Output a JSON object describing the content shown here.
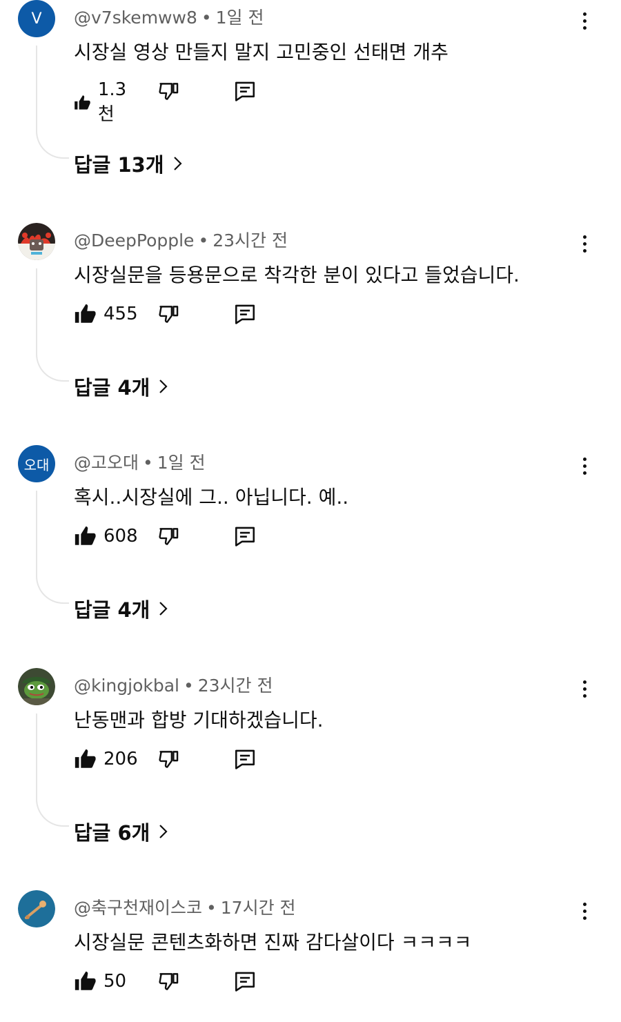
{
  "comments": [
    {
      "avatar_letter": "V",
      "author": "@v7skemww8",
      "time": "1일 전",
      "text": "시장실 영상 만들지 말지 고민중인 선태면 개추",
      "likes": "1.3천",
      "replies_label": "답글 13개"
    },
    {
      "author": "@DeepPopple",
      "time": "23시간 전",
      "text": "시장실문을 등용문으로 착각한 분이 있다고 들었습니다.",
      "likes": "455",
      "replies_label": "답글 4개"
    },
    {
      "avatar_text": "오대",
      "author": "@고오대",
      "time": "1일 전",
      "text": "혹시..시장실에 그.. 아닙니다. 예..",
      "likes": "608",
      "replies_label": "답글 4개"
    },
    {
      "author": "@kingjokbal",
      "time": "23시간 전",
      "text": "난동맨과 합방 기대하겠습니다.",
      "likes": "206",
      "replies_label": "답글 6개"
    },
    {
      "author": "@축구천재이스코",
      "time": "17시간 전",
      "text": "시장실문 콘텐츠화하면 진짜 감다살이다 ㅋㅋㅋㅋ",
      "likes": "50"
    }
  ],
  "colors": {
    "avatar_blue": "#0d5aa7",
    "meta_gray": "#606060",
    "text": "#0f0f0f",
    "thread_line": "#e5e5e5"
  }
}
